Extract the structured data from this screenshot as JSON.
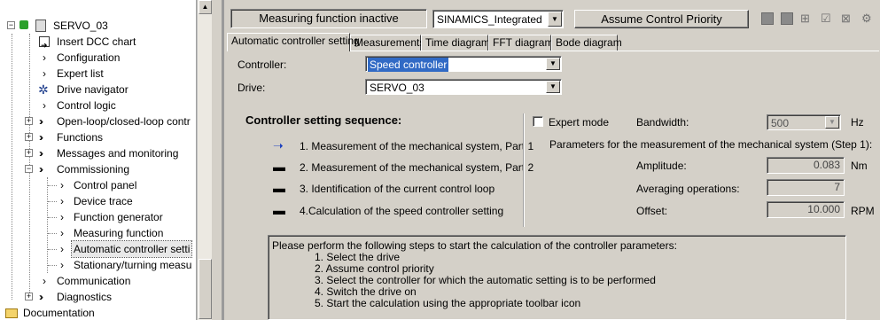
{
  "tree": {
    "items": [
      {
        "label": "SERVO_03",
        "icon": "drive-unit-icon"
      },
      {
        "label": "Insert DCC chart",
        "icon": "insert-chart-icon"
      },
      {
        "label": "Configuration"
      },
      {
        "label": "Expert list"
      },
      {
        "label": "Drive navigator",
        "icon": "navigator-icon"
      },
      {
        "label": "Control logic"
      },
      {
        "label": "Open-loop/closed-loop contr"
      },
      {
        "label": "Functions"
      },
      {
        "label": "Messages and monitoring"
      },
      {
        "label": "Commissioning"
      },
      {
        "label": "Control panel"
      },
      {
        "label": "Device trace"
      },
      {
        "label": "Function generator"
      },
      {
        "label": "Measuring function"
      },
      {
        "label": "Automatic controller setti"
      },
      {
        "label": "Stationary/turning measu"
      },
      {
        "label": "Communication"
      },
      {
        "label": "Diagnostics"
      },
      {
        "label": "Documentation",
        "icon": "folder-icon"
      }
    ]
  },
  "toolbar": {
    "status": "Measuring function inactive",
    "source": "SINAMICS_Integrated",
    "priority_button": "Assume Control Priority"
  },
  "tabs": [
    {
      "label": "Automatic controller setting",
      "active": true
    },
    {
      "label": "Measurements"
    },
    {
      "label": "Time diagram"
    },
    {
      "label": "FFT diagram"
    },
    {
      "label": "Bode diagram"
    }
  ],
  "form": {
    "controller_label": "Controller:",
    "controller_value": "Speed controller",
    "drive_label": "Drive:",
    "drive_value": "SERVO_03"
  },
  "sequence": {
    "title": "Controller setting sequence:",
    "steps": [
      {
        "text": "1. Measurement of the mechanical system, Part 1",
        "current": true
      },
      {
        "text": "2. Measurement of the mechanical system, Part 2"
      },
      {
        "text": "3. Identification of the current control loop"
      },
      {
        "text": "4.Calculation of the speed controller setting"
      }
    ]
  },
  "params": {
    "expert_mode_label": "Expert mode",
    "expert_mode_checked": false,
    "bandwidth_label": "Bandwidth:",
    "bandwidth_value": "500",
    "bandwidth_unit": "Hz",
    "heading": "Parameters for the measurement of the mechanical system (Step 1):",
    "amplitude_label": "Amplitude:",
    "amplitude_value": "0.083",
    "amplitude_unit": "Nm",
    "averaging_label": "Averaging operations:",
    "averaging_value": "7",
    "offset_label": "Offset:",
    "offset_value": "10.000",
    "offset_unit": "RPM"
  },
  "instructions": {
    "intro": "Please perform the following steps to start the calculation of the controller parameters:",
    "steps": [
      "1. Select the drive",
      "2. Assume control priority",
      "3. Select the controller for which the automatic setting is to be performed",
      "4. Switch the drive on",
      "5. Start the calculation using the appropriate toolbar icon"
    ]
  },
  "colors": {
    "selection": "#316ac5",
    "panel": "#d4d0c8",
    "current_step_arrow": "#1a3fbf"
  }
}
